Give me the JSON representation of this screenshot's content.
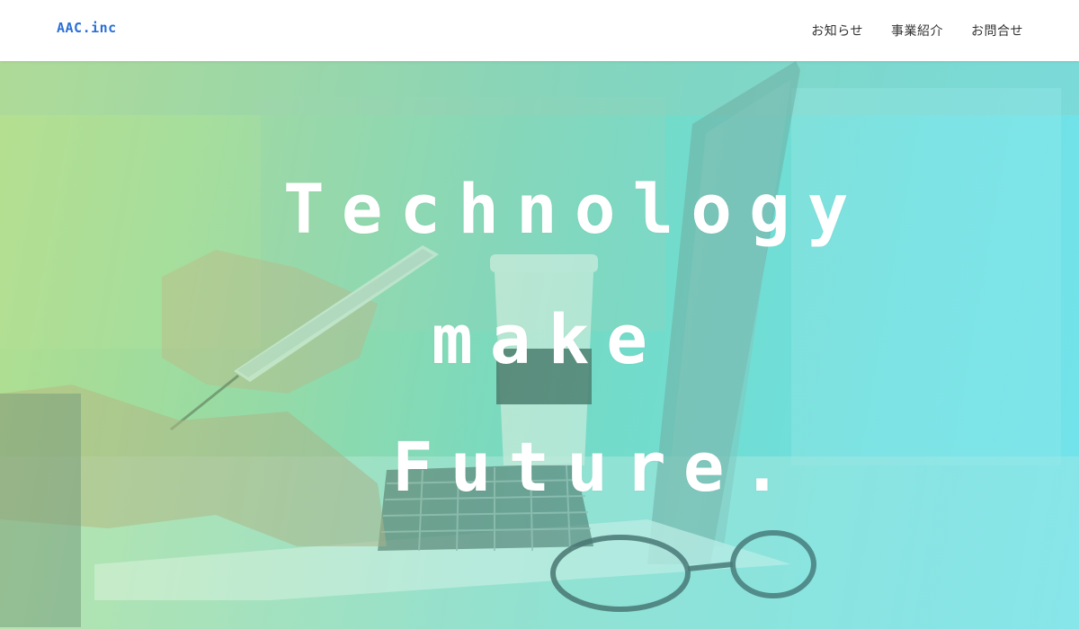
{
  "header": {
    "logo": "AAC.inc",
    "nav": [
      {
        "label": "お知らせ"
      },
      {
        "label": "事業紹介"
      },
      {
        "label": "お問合せ"
      }
    ]
  },
  "hero": {
    "lines": [
      "Technology",
      "make",
      "Future."
    ]
  },
  "colors": {
    "logo": "#2a6fd6",
    "nav_text": "#333333",
    "hero_gradient_start": "#a9d88f",
    "hero_gradient_end": "#7ee6ec",
    "headline": "#ffffff"
  }
}
